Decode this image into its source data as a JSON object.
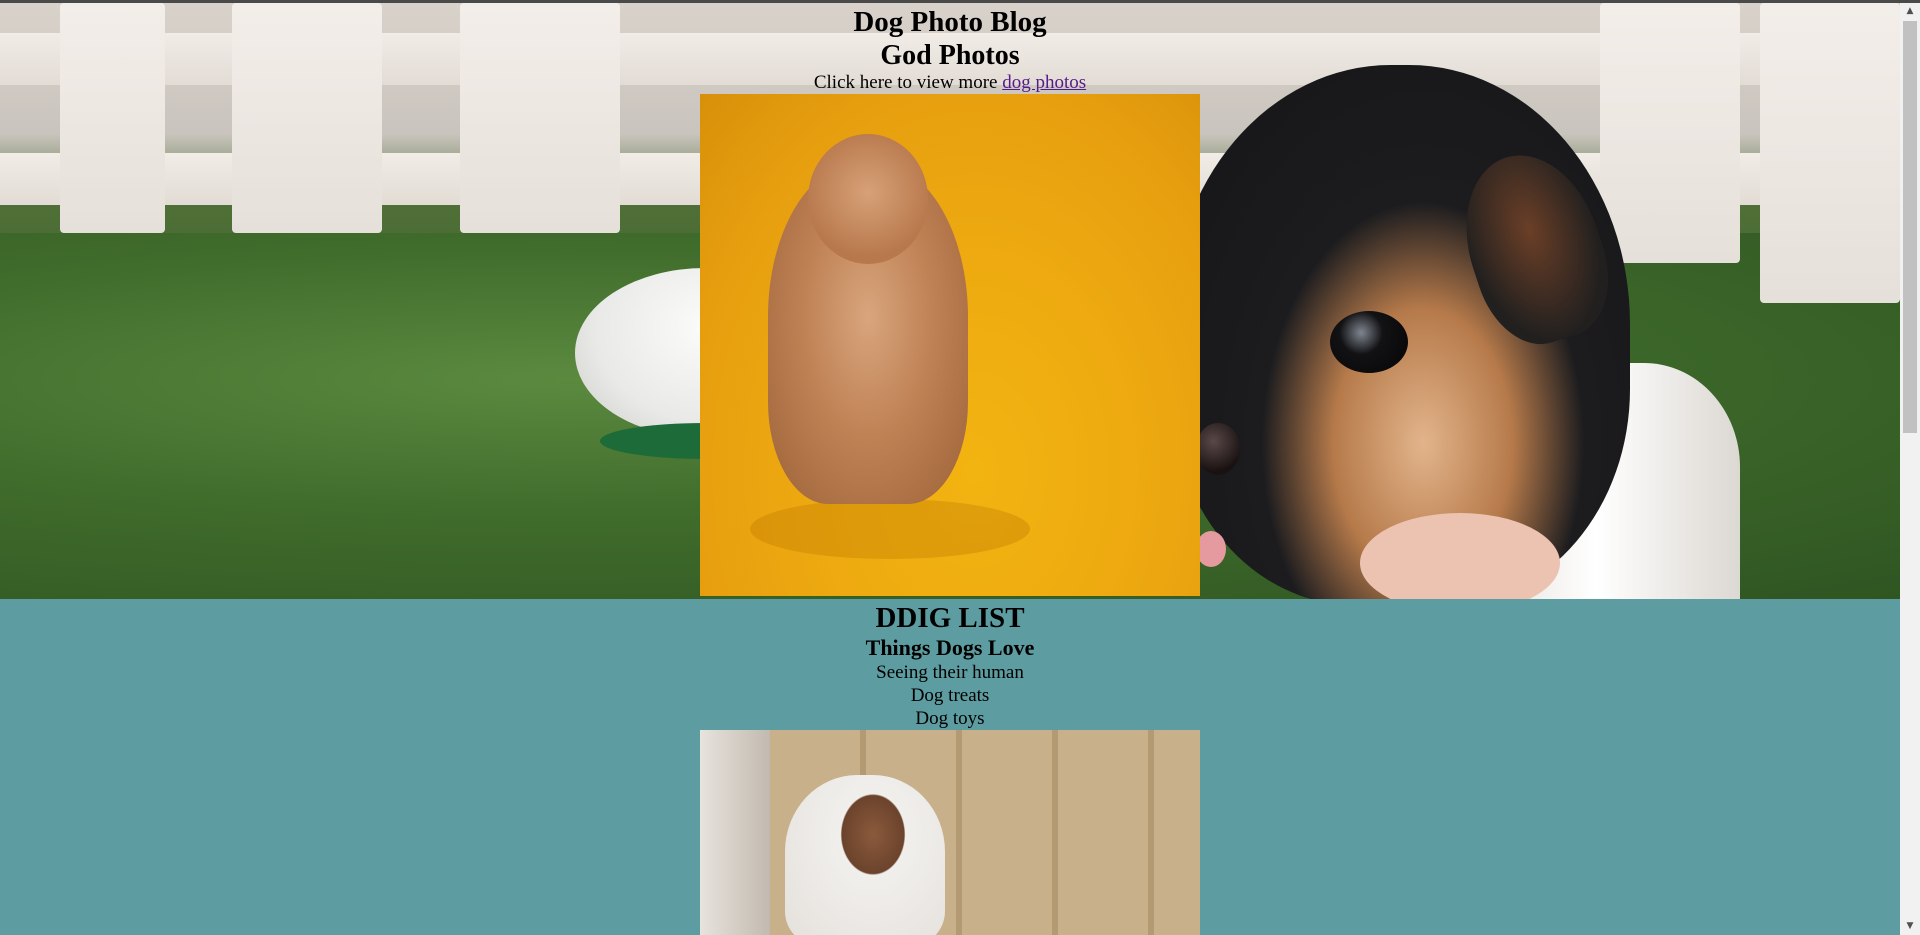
{
  "hero": {
    "title": "Dog Photo Blog",
    "subtitle": "God Photos",
    "intro_text": "Click here to view more ",
    "intro_link": "dog photos"
  },
  "list_section": {
    "title": "DDIG LIST",
    "subtitle": "Things Dogs Love",
    "items": [
      "Seeing their human",
      "Dog treats",
      "Dog toys"
    ]
  },
  "colors": {
    "section_background": "#5d9ca0",
    "link": "#551a8b"
  }
}
